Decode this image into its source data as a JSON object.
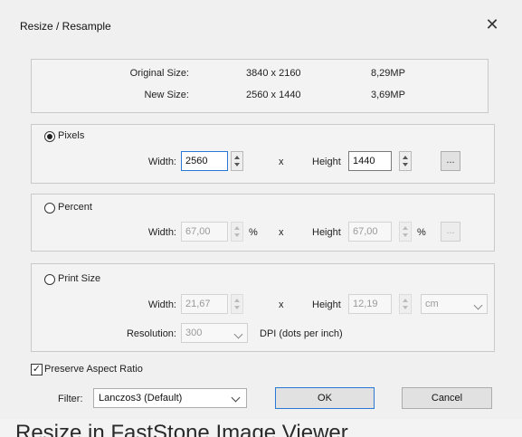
{
  "dialog": {
    "title": "Resize / Resample",
    "close_glyph": "✕"
  },
  "info": {
    "original_label": "Original Size:",
    "original_dims": "3840 x 2160",
    "original_mp": "8,29MP",
    "new_label": "New Size:",
    "new_dims": "2560 x 1440",
    "new_mp": "3,69MP"
  },
  "pixels": {
    "label": "Pixels",
    "selected": true,
    "width_label": "Width:",
    "width_value": "2560",
    "x_label": "x",
    "height_label": "Height",
    "height_value": "1440",
    "more_label": "..."
  },
  "percent": {
    "label": "Percent",
    "width_label": "Width:",
    "width_value": "67,00",
    "unit1": "%",
    "x_label": "x",
    "height_label": "Height",
    "height_value": "67,00",
    "unit2": "%",
    "more_label": "..."
  },
  "print": {
    "label": "Print Size",
    "width_label": "Width:",
    "width_value": "21,67",
    "x_label": "x",
    "height_label": "Height",
    "height_value": "12,19",
    "unit_value": "cm",
    "resolution_label": "Resolution:",
    "resolution_value": "300",
    "dpi_label": "DPI (dots per inch)"
  },
  "footer": {
    "preserve_label": "Preserve Aspect Ratio",
    "preserve_checked": true,
    "check_glyph": "✓",
    "filter_label": "Filter:",
    "filter_value": "Lanczos3 (Default)",
    "ok_label": "OK",
    "cancel_label": "Cancel"
  },
  "caption": "Resize in FastStone Image Viewer"
}
